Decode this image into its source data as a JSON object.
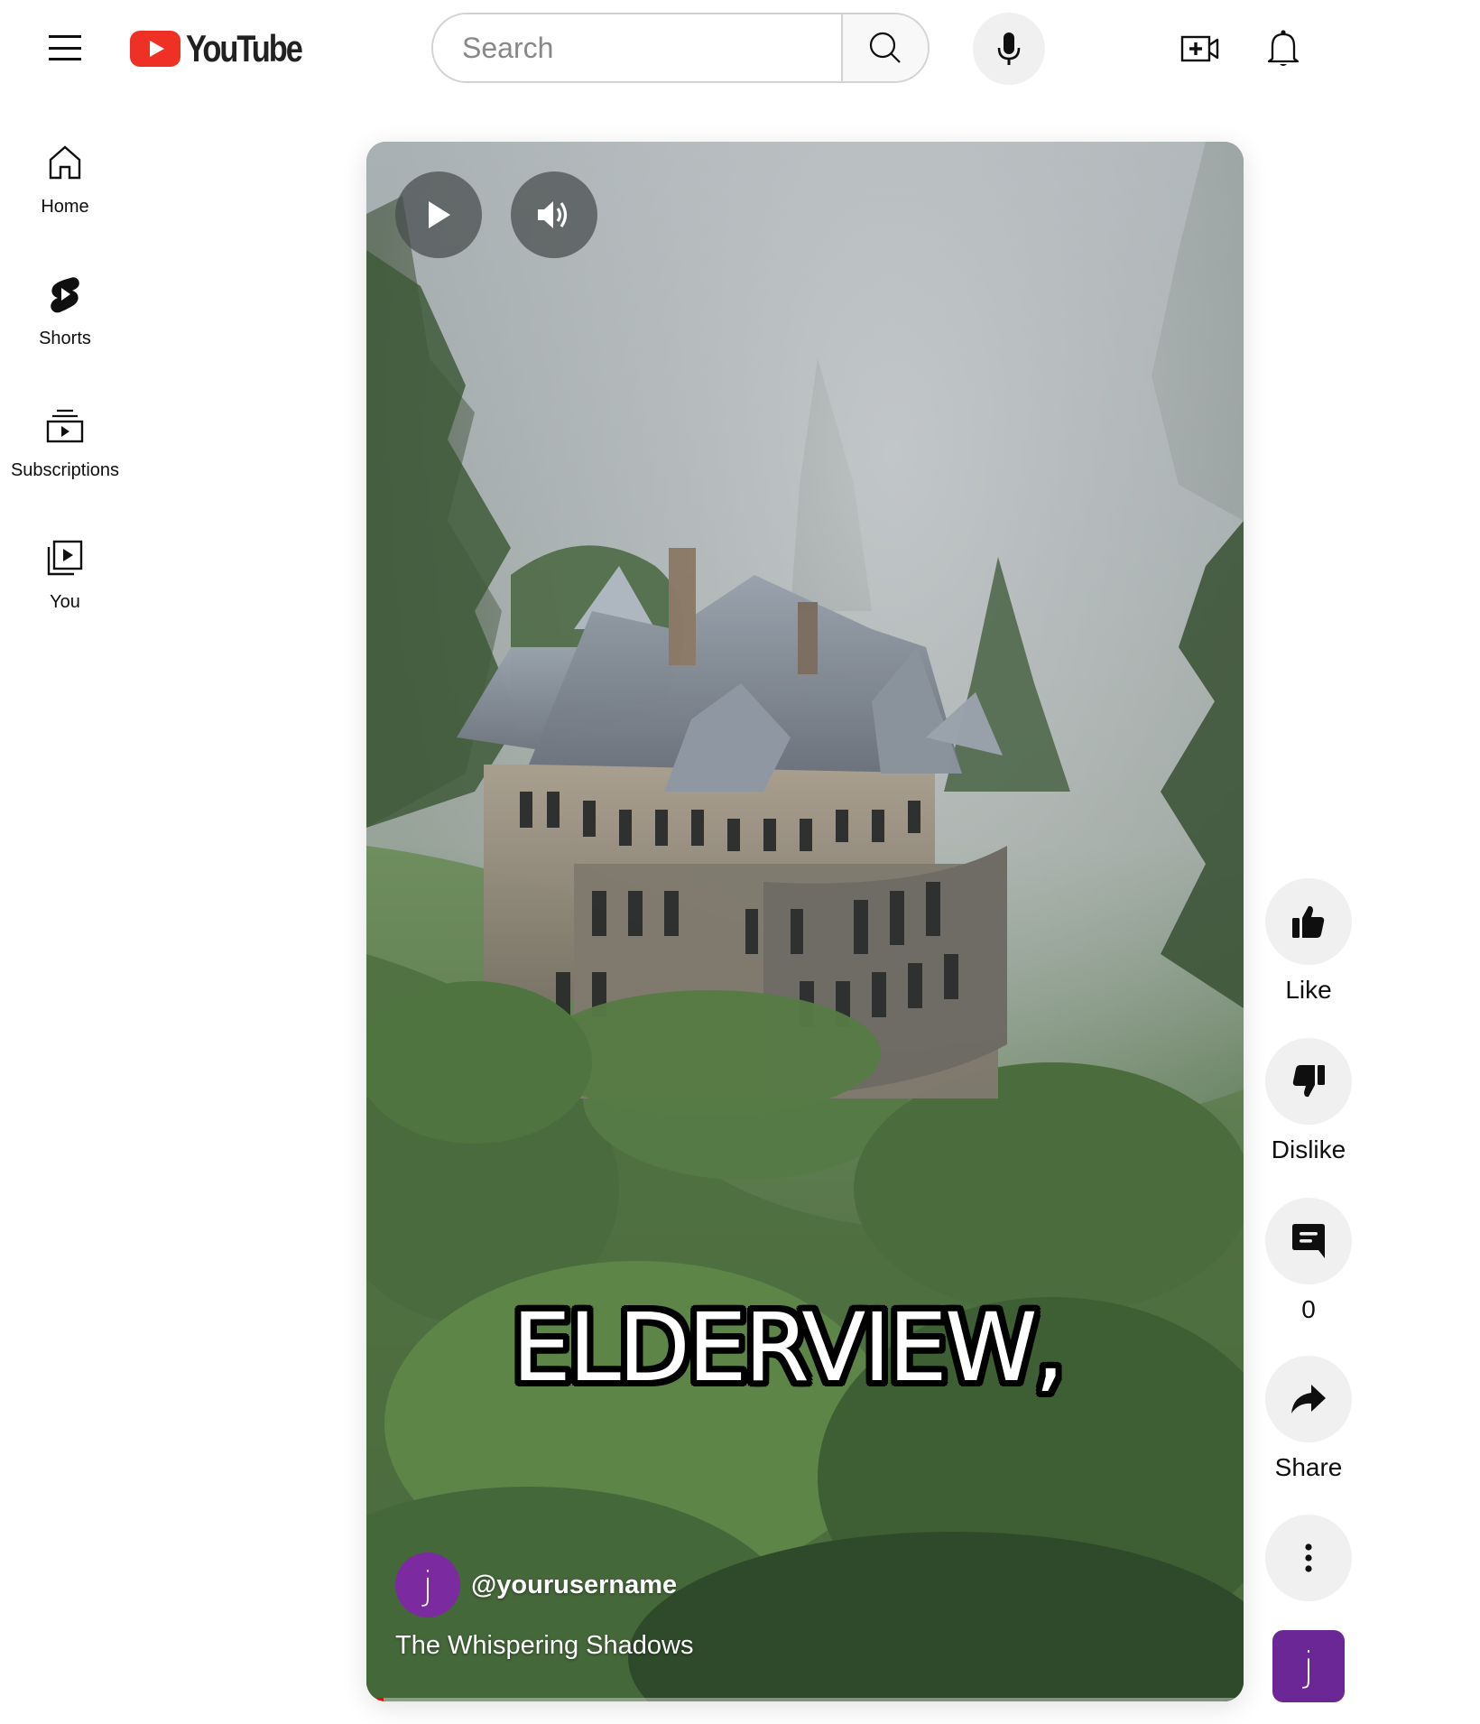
{
  "header": {
    "logo_text": "YouTube",
    "search_placeholder": "Search",
    "search_value": ""
  },
  "sidebar": {
    "items": [
      {
        "label": "Home",
        "icon": "home-icon"
      },
      {
        "label": "Shorts",
        "icon": "shorts-icon"
      },
      {
        "label": "Subscriptions",
        "icon": "subscriptions-icon"
      },
      {
        "label": "You",
        "icon": "you-library-icon"
      }
    ]
  },
  "video": {
    "caption": "ELDERVIEW,",
    "channel_handle": "@yourusername",
    "channel_initial": "j",
    "title": "The Whispering Shadows",
    "progress_fraction": 0.02,
    "state": {
      "playing": false,
      "muted": false
    }
  },
  "actions": {
    "like_label": "Like",
    "dislike_label": "Dislike",
    "comments_count": "0",
    "share_label": "Share",
    "sound_initial": "j"
  },
  "colors": {
    "brand_red": "#ee3124",
    "avatar_purple": "#7b2aa0",
    "sound_thumb_purple": "#6c2797",
    "progress_red": "#ff0000",
    "action_bg": "#f0f0f0"
  }
}
